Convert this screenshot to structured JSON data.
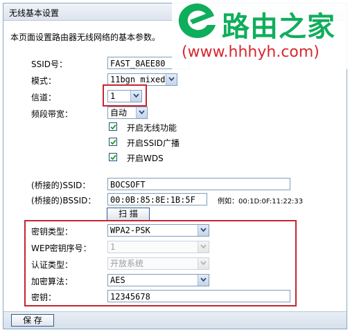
{
  "window": {
    "title": "无线基本设置"
  },
  "intro": "本页面设置路由器无线网络的基本参数。",
  "form": {
    "ssid": {
      "label": "SSID号：",
      "value": "FAST_8AEE80"
    },
    "mode": {
      "label": "模式：",
      "value": "11bgn mixed"
    },
    "channel": {
      "label": "信道：",
      "value": "1"
    },
    "bandwidth": {
      "label": "频段带宽：",
      "value": "自动"
    },
    "checkboxes": [
      {
        "label": "开启无线功能",
        "checked": true
      },
      {
        "label": "开启SSID广播",
        "checked": true
      },
      {
        "label": "开启WDS",
        "checked": true
      }
    ],
    "bridge_ssid": {
      "label": "(桥接的)SSID：",
      "value": "BOCSOFT"
    },
    "bridge_bssid": {
      "label": "(桥接的)BSSID：",
      "value": "00:0B:85:8E:1B:5F",
      "example": "例如：00:1D:0F:11:22:33"
    },
    "scan_button": "扫 描",
    "key_type": {
      "label": "密钥类型：",
      "value": "WPA2-PSK"
    },
    "wep_index": {
      "label": "WEP密钥序号：",
      "value": "1"
    },
    "auth_type": {
      "label": "认证类型：",
      "value": "开放系统"
    },
    "encryption": {
      "label": "加密算法：",
      "value": "AES"
    },
    "key": {
      "label": "密钥：",
      "value": "12345678"
    }
  },
  "save_button": "保 存",
  "watermark": {
    "brand": "路由之家",
    "url": "(www.hhhyh.com)"
  },
  "colors": {
    "highlight": "#c2262e",
    "brand": "#0fae5c",
    "title_bar": "#dde4ee"
  },
  "icons": {
    "dropdown": "chevron-down-icon",
    "checkbox": "checkmark-icon",
    "logo": "e-logo-icon"
  }
}
